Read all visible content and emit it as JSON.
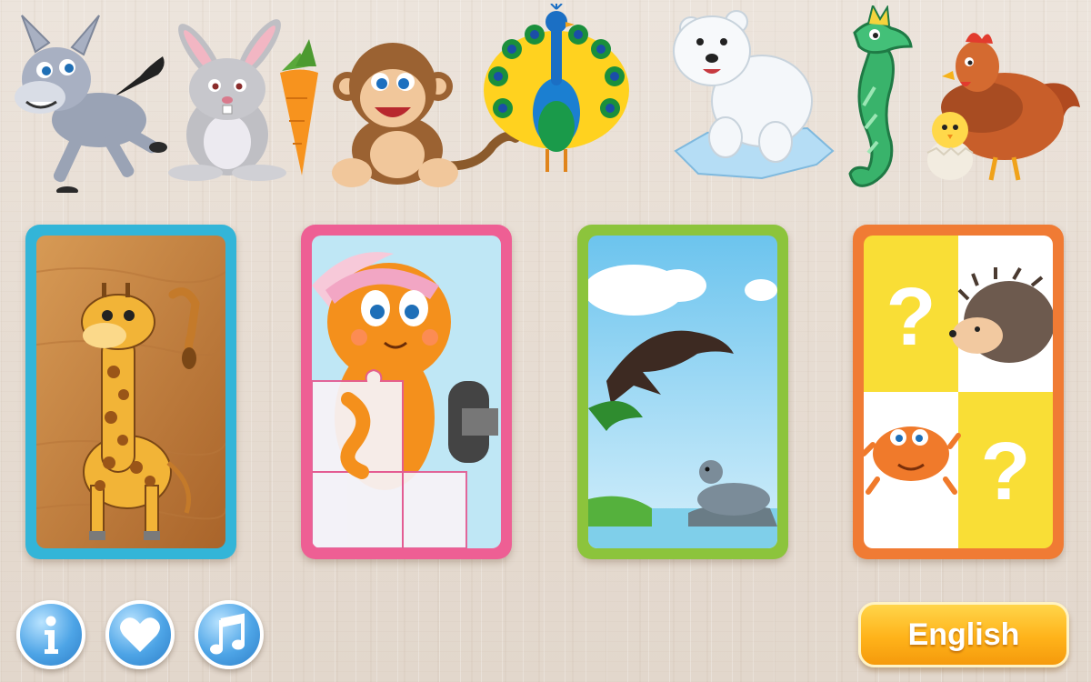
{
  "header": {
    "animals": [
      {
        "name": "donkey"
      },
      {
        "name": "rabbit"
      },
      {
        "name": "monkey"
      },
      {
        "name": "peacock"
      },
      {
        "name": "polar-bear"
      },
      {
        "name": "seahorse"
      },
      {
        "name": "hen-and-chick"
      }
    ]
  },
  "cards": [
    {
      "game": "shape-puzzle",
      "image": "giraffe",
      "frame_color": "#33b5d8"
    },
    {
      "game": "jigsaw-puzzle",
      "image": "octopus",
      "frame_color": "#ee5f94"
    },
    {
      "game": "silhouette-match",
      "image": "dolphin-and-seal",
      "frame_color": "#8cc43c"
    },
    {
      "game": "memory-cards",
      "image": "hedgehog-and-crab",
      "frame_color": "#f07b34"
    }
  ],
  "footer": {
    "buttons": [
      {
        "icon": "info-icon"
      },
      {
        "icon": "heart-icon"
      },
      {
        "icon": "music-note-icon"
      }
    ],
    "language_label": "English"
  },
  "colors": {
    "background": "#e7ddd3",
    "button_blue": "#4da4e6",
    "language_button": "#ffb31a"
  }
}
